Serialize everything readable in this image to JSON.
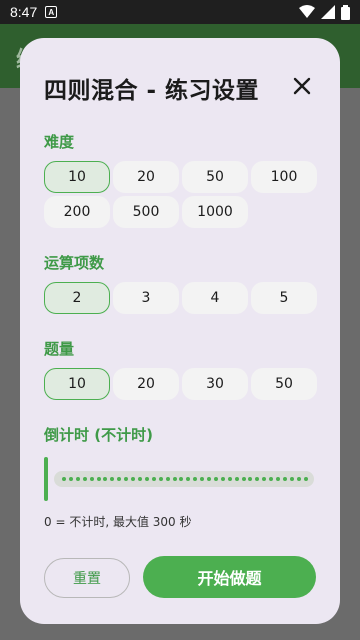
{
  "status_bar": {
    "time": "8:47",
    "notification_icon": "A"
  },
  "app_bar": {
    "title_fragment": "练"
  },
  "dialog": {
    "title": "四则混合 - 练习设置",
    "difficulty": {
      "label": "难度",
      "options": [
        "10",
        "20",
        "50",
        "100",
        "200",
        "500",
        "1000"
      ],
      "selected": "10"
    },
    "terms": {
      "label": "运算项数",
      "options": [
        "2",
        "3",
        "4",
        "5"
      ],
      "selected": "2"
    },
    "count": {
      "label": "题量",
      "options": [
        "10",
        "20",
        "30",
        "50"
      ],
      "selected": "10"
    },
    "countdown": {
      "label": "倒计时 (不计时)",
      "value": 0,
      "max": 300,
      "hint": "0 = 不计时, 最大值 300 秒"
    },
    "buttons": {
      "reset": "重置",
      "start": "开始做题"
    }
  },
  "colors": {
    "accent": "#4caf50",
    "label_green": "#3f9a48",
    "dialog_bg": "#ece7f2"
  }
}
